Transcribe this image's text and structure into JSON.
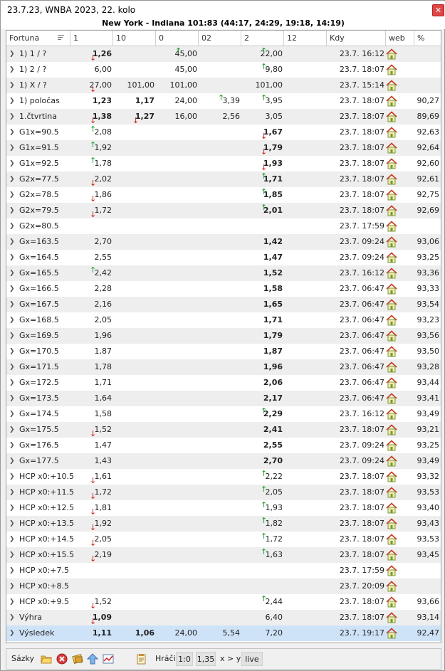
{
  "window": {
    "title": "23.7.23, WNBA 2023, 22. kolo",
    "close_glyph": "✕"
  },
  "match": {
    "header": "New York - Indiana 101:83 (44:17, 24:29, 19:18, 14:19)"
  },
  "columns": [
    "Fortuna",
    "1",
    "10",
    "0",
    "02",
    "2",
    "12",
    "Kdy",
    "web",
    "%"
  ],
  "rows": [
    {
      "name": "1) 1 / ?",
      "c1": "1,26",
      "c1b": true,
      "c1a": "dn",
      "c0": "45,00",
      "c0a": "up",
      "c2": "22,00",
      "c2a": "up",
      "kdy": "23.7. 16:12"
    },
    {
      "name": "1) 2 / ?",
      "c1": "6,00",
      "c0": "45,00",
      "c2": "9,80",
      "c2a": "up",
      "kdy": "23.7. 18:07"
    },
    {
      "name": "1) X / ?",
      "c1": "27,00",
      "c1a": "dn",
      "c10": "101,00",
      "c0": "101,00",
      "c2": "101,00",
      "kdy": "23.7. 15:14"
    },
    {
      "name": "1) poločas",
      "c1": "1,23",
      "c1b": true,
      "c10": "1,17",
      "c10b": true,
      "c0": "24,00",
      "c02": "3,39",
      "c02a": "up",
      "c2": "3,95",
      "c2a": "up",
      "kdy": "23.7. 18:07",
      "pct": "90,27"
    },
    {
      "name": "1.čtvrtina",
      "c1": "1,38",
      "c1b": true,
      "c1a": "dn",
      "c10": "1,27",
      "c10b": true,
      "c10a": "dn",
      "c0": "16,00",
      "c02": "2,56",
      "c2": "3,05",
      "kdy": "23.7. 18:07",
      "pct": "89,69"
    },
    {
      "name": "G1x=90.5",
      "c1": "2,08",
      "c1a": "up",
      "c2": "1,67",
      "c2b": true,
      "c2a": "dn",
      "kdy": "23.7. 18:07",
      "pct": "92,63"
    },
    {
      "name": "G1x=91.5",
      "c1": "1,92",
      "c1a": "up",
      "c2": "1,79",
      "c2b": true,
      "c2a": "dn",
      "kdy": "23.7. 18:07",
      "pct": "92,64"
    },
    {
      "name": "G1x=92.5",
      "c1": "1,78",
      "c1a": "up",
      "c2": "1,93",
      "c2b": true,
      "c2a": "dn",
      "kdy": "23.7. 18:07",
      "pct": "92,60"
    },
    {
      "name": "G2x=77.5",
      "c1": "2,02",
      "c1a": "dn",
      "c2": "1,71",
      "c2b": true,
      "c2a": "up",
      "kdy": "23.7. 18:07",
      "pct": "92,61"
    },
    {
      "name": "G2x=78.5",
      "c1": "1,86",
      "c1a": "dn",
      "c2": "1,85",
      "c2b": true,
      "c2a": "up",
      "kdy": "23.7. 18:07",
      "pct": "92,75"
    },
    {
      "name": "G2x=79.5",
      "c1": "1,72",
      "c1a": "dn",
      "c2": "2,01",
      "c2b": true,
      "c2a": "up",
      "kdy": "23.7. 18:07",
      "pct": "92,69"
    },
    {
      "name": "G2x=80.5",
      "kdy": "23.7. 17:59"
    },
    {
      "name": "Gx=163.5",
      "c1": "2,70",
      "c2": "1,42",
      "c2b": true,
      "kdy": "23.7. 09:24",
      "pct": "93,06"
    },
    {
      "name": "Gx=164.5",
      "c1": "2,55",
      "c2": "1,47",
      "c2b": true,
      "kdy": "23.7. 09:24",
      "pct": "93,25"
    },
    {
      "name": "Gx=165.5",
      "c1": "2,42",
      "c1a": "up",
      "c2": "1,52",
      "c2b": true,
      "kdy": "23.7. 16:12",
      "pct": "93,36"
    },
    {
      "name": "Gx=166.5",
      "c1": "2,28",
      "c2": "1,58",
      "c2b": true,
      "kdy": "23.7. 06:47",
      "pct": "93,33"
    },
    {
      "name": "Gx=167.5",
      "c1": "2,16",
      "c2": "1,65",
      "c2b": true,
      "kdy": "23.7. 06:47",
      "pct": "93,54"
    },
    {
      "name": "Gx=168.5",
      "c1": "2,05",
      "c2": "1,71",
      "c2b": true,
      "kdy": "23.7. 06:47",
      "pct": "93,23"
    },
    {
      "name": "Gx=169.5",
      "c1": "1,96",
      "c2": "1,79",
      "c2b": true,
      "kdy": "23.7. 06:47",
      "pct": "93,56"
    },
    {
      "name": "Gx=170.5",
      "c1": "1,87",
      "c2": "1,87",
      "c2b": true,
      "kdy": "23.7. 06:47",
      "pct": "93,50"
    },
    {
      "name": "Gx=171.5",
      "c1": "1,78",
      "c2": "1,96",
      "c2b": true,
      "kdy": "23.7. 06:47",
      "pct": "93,28"
    },
    {
      "name": "Gx=172.5",
      "c1": "1,71",
      "c2": "2,06",
      "c2b": true,
      "kdy": "23.7. 06:47",
      "pct": "93,44"
    },
    {
      "name": "Gx=173.5",
      "c1": "1,64",
      "c2": "2,17",
      "c2b": true,
      "kdy": "23.7. 06:47",
      "pct": "93,41"
    },
    {
      "name": "Gx=174.5",
      "c1": "1,58",
      "c2": "2,29",
      "c2b": true,
      "c2a": "up",
      "kdy": "23.7. 16:12",
      "pct": "93,49"
    },
    {
      "name": "Gx=175.5",
      "c1": "1,52",
      "c1a": "dn",
      "c2": "2,41",
      "c2b": true,
      "kdy": "23.7. 18:07",
      "pct": "93,21"
    },
    {
      "name": "Gx=176.5",
      "c1": "1,47",
      "c2": "2,55",
      "c2b": true,
      "kdy": "23.7. 09:24",
      "pct": "93,25"
    },
    {
      "name": "Gx=177.5",
      "c1": "1,43",
      "c2": "2,70",
      "c2b": true,
      "kdy": "23.7. 09:24",
      "pct": "93,49"
    },
    {
      "name": "HCP x0:+10.5",
      "c1": "1,61",
      "c1a": "dn",
      "c2": "2,22",
      "c2a": "up",
      "kdy": "23.7. 18:07",
      "pct": "93,32"
    },
    {
      "name": "HCP x0:+11.5",
      "c1": "1,72",
      "c1a": "dn",
      "c2": "2,05",
      "c2a": "up",
      "kdy": "23.7. 18:07",
      "pct": "93,53"
    },
    {
      "name": "HCP x0:+12.5",
      "c1": "1,81",
      "c1a": "dn",
      "c2": "1,93",
      "c2a": "up",
      "kdy": "23.7. 18:07",
      "pct": "93,40"
    },
    {
      "name": "HCP x0:+13.5",
      "c1": "1,92",
      "c1a": "dn",
      "c2": "1,82",
      "c2a": "up",
      "kdy": "23.7. 18:07",
      "pct": "93,43"
    },
    {
      "name": "HCP x0:+14.5",
      "c1": "2,05",
      "c1a": "dn",
      "c2": "1,72",
      "c2a": "up",
      "kdy": "23.7. 18:07",
      "pct": "93,53"
    },
    {
      "name": "HCP x0:+15.5",
      "c1": "2,19",
      "c1a": "dn",
      "c2": "1,63",
      "c2a": "up",
      "kdy": "23.7. 18:07",
      "pct": "93,45"
    },
    {
      "name": "HCP x0:+7.5",
      "kdy": "23.7. 17:59"
    },
    {
      "name": "HCP x0:+8.5",
      "kdy": "23.7. 20:09"
    },
    {
      "name": "HCP x0:+9.5",
      "c1": "1,52",
      "c1a": "dn",
      "c2": "2,44",
      "c2a": "up",
      "kdy": "23.7. 18:07",
      "pct": "93,66"
    },
    {
      "name": "Výhra",
      "c1": "1,09",
      "c1b": true,
      "c1a": "dn",
      "c2": "6,40",
      "kdy": "23.7. 18:07",
      "pct": "93,14"
    },
    {
      "name": "Výsledek",
      "c1": "1,11",
      "c1b": true,
      "c10": "1,06",
      "c10b": true,
      "c0": "24,00",
      "c02": "5,54",
      "c2": "7,20",
      "kdy": "23.7. 19:17",
      "pct": "92,47",
      "selected": true
    }
  ],
  "toolbar": {
    "bets_label": "Sázky",
    "players_label": "Hráči",
    "btn_score": "1:0",
    "btn_odds": "1,35",
    "btn_xy": "x > y",
    "btn_live": "live"
  },
  "colors": {
    "up_arrow": "#1a9a2a",
    "down_arrow": "#d01818",
    "selected_row": "#cfe3f8",
    "close": "#e04545"
  }
}
